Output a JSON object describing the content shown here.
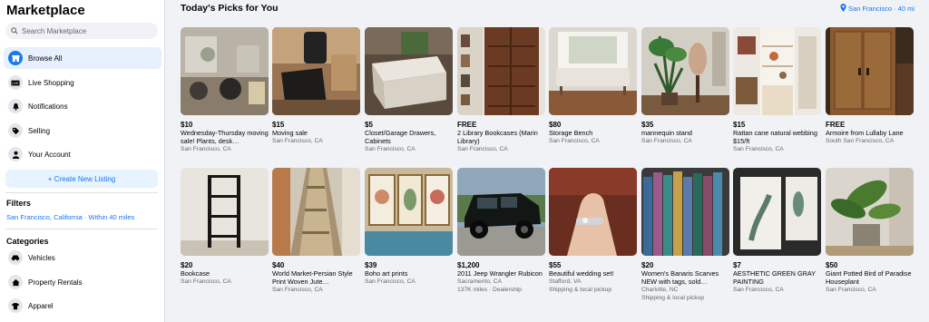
{
  "sidebar": {
    "title": "Marketplace",
    "search_placeholder": "Search Marketplace",
    "nav": [
      {
        "label": "Browse All",
        "icon": "storefront-icon"
      },
      {
        "label": "Live Shopping",
        "icon": "live-icon"
      },
      {
        "label": "Notifications",
        "icon": "bell-icon"
      },
      {
        "label": "Selling",
        "icon": "tag-icon"
      },
      {
        "label": "Your Account",
        "icon": "person-icon"
      }
    ],
    "create_label": "+ Create New Listing",
    "filters_heading": "Filters",
    "filter_location": "San Francisco, California · Within 40 miles",
    "categories_heading": "Categories",
    "categories": [
      {
        "label": "Vehicles",
        "icon": "car-icon"
      },
      {
        "label": "Property Rentals",
        "icon": "house-icon"
      },
      {
        "label": "Apparel",
        "icon": "shirt-icon"
      }
    ]
  },
  "main": {
    "title": "Today's Picks for You",
    "location": "San Francisco · 40 mi"
  },
  "listings": [
    {
      "price": "$10",
      "title": "Wednesday-Thursday moving sale! Plants, desk…",
      "location": "San Francisco, CA",
      "extra": ""
    },
    {
      "price": "$15",
      "title": "Moving sale",
      "location": "San Francisco, CA",
      "extra": ""
    },
    {
      "price": "$5",
      "title": "Closet/Garage Drawers, Cabinets",
      "location": "San Francisco, CA",
      "extra": ""
    },
    {
      "price": "FREE",
      "title": "2 Library Bookcases (Marin Library)",
      "location": "San Francisco, CA",
      "extra": ""
    },
    {
      "price": "$80",
      "title": "Storage Bench",
      "location": "San Francisco, CA",
      "extra": ""
    },
    {
      "price": "$35",
      "title": "mannequin stand",
      "location": "San Francisco, CA",
      "extra": ""
    },
    {
      "price": "$15",
      "title": "Rattan cane natural webbing $15/ft",
      "location": "San Francisco, CA",
      "extra": ""
    },
    {
      "price": "FREE",
      "title": "Armoire from Lullaby Lane",
      "location": "South San Francisco, CA",
      "extra": ""
    },
    {
      "price": "$20",
      "title": "Bookcase",
      "location": "San Francisco, CA",
      "extra": ""
    },
    {
      "price": "$40",
      "title": "World Market-Persian Style Print Woven Jute…",
      "location": "San Francisco, CA",
      "extra": ""
    },
    {
      "price": "$39",
      "title": "Boho art prints",
      "location": "San Francisco, CA",
      "extra": ""
    },
    {
      "price": "$1,200",
      "title": "2011 Jeep Wrangler Rubicon",
      "location": "Sacramento, CA",
      "extra": "137K miles · Dealership"
    },
    {
      "price": "$55",
      "title": "Beautiful wedding set!",
      "location": "Stafford, VA",
      "extra": "Shipping & local pickup"
    },
    {
      "price": "$20",
      "title": "Women's Banaris Scarves NEW with tags, sold…",
      "location": "Charlotte, NC",
      "extra": "Shipping & local pickup"
    },
    {
      "price": "$7",
      "title": "AESTHETIC GREEN GRAY PAINTING",
      "location": "San Francisco, CA",
      "extra": ""
    },
    {
      "price": "$50",
      "title": "Giant Potted Bird of Paradise Houseplant",
      "location": "San Francisco, CA",
      "extra": ""
    }
  ],
  "colors": {
    "accent": "#1877f2",
    "active_bg": "#e7f0fd",
    "page_bg": "#f0f2f5"
  }
}
